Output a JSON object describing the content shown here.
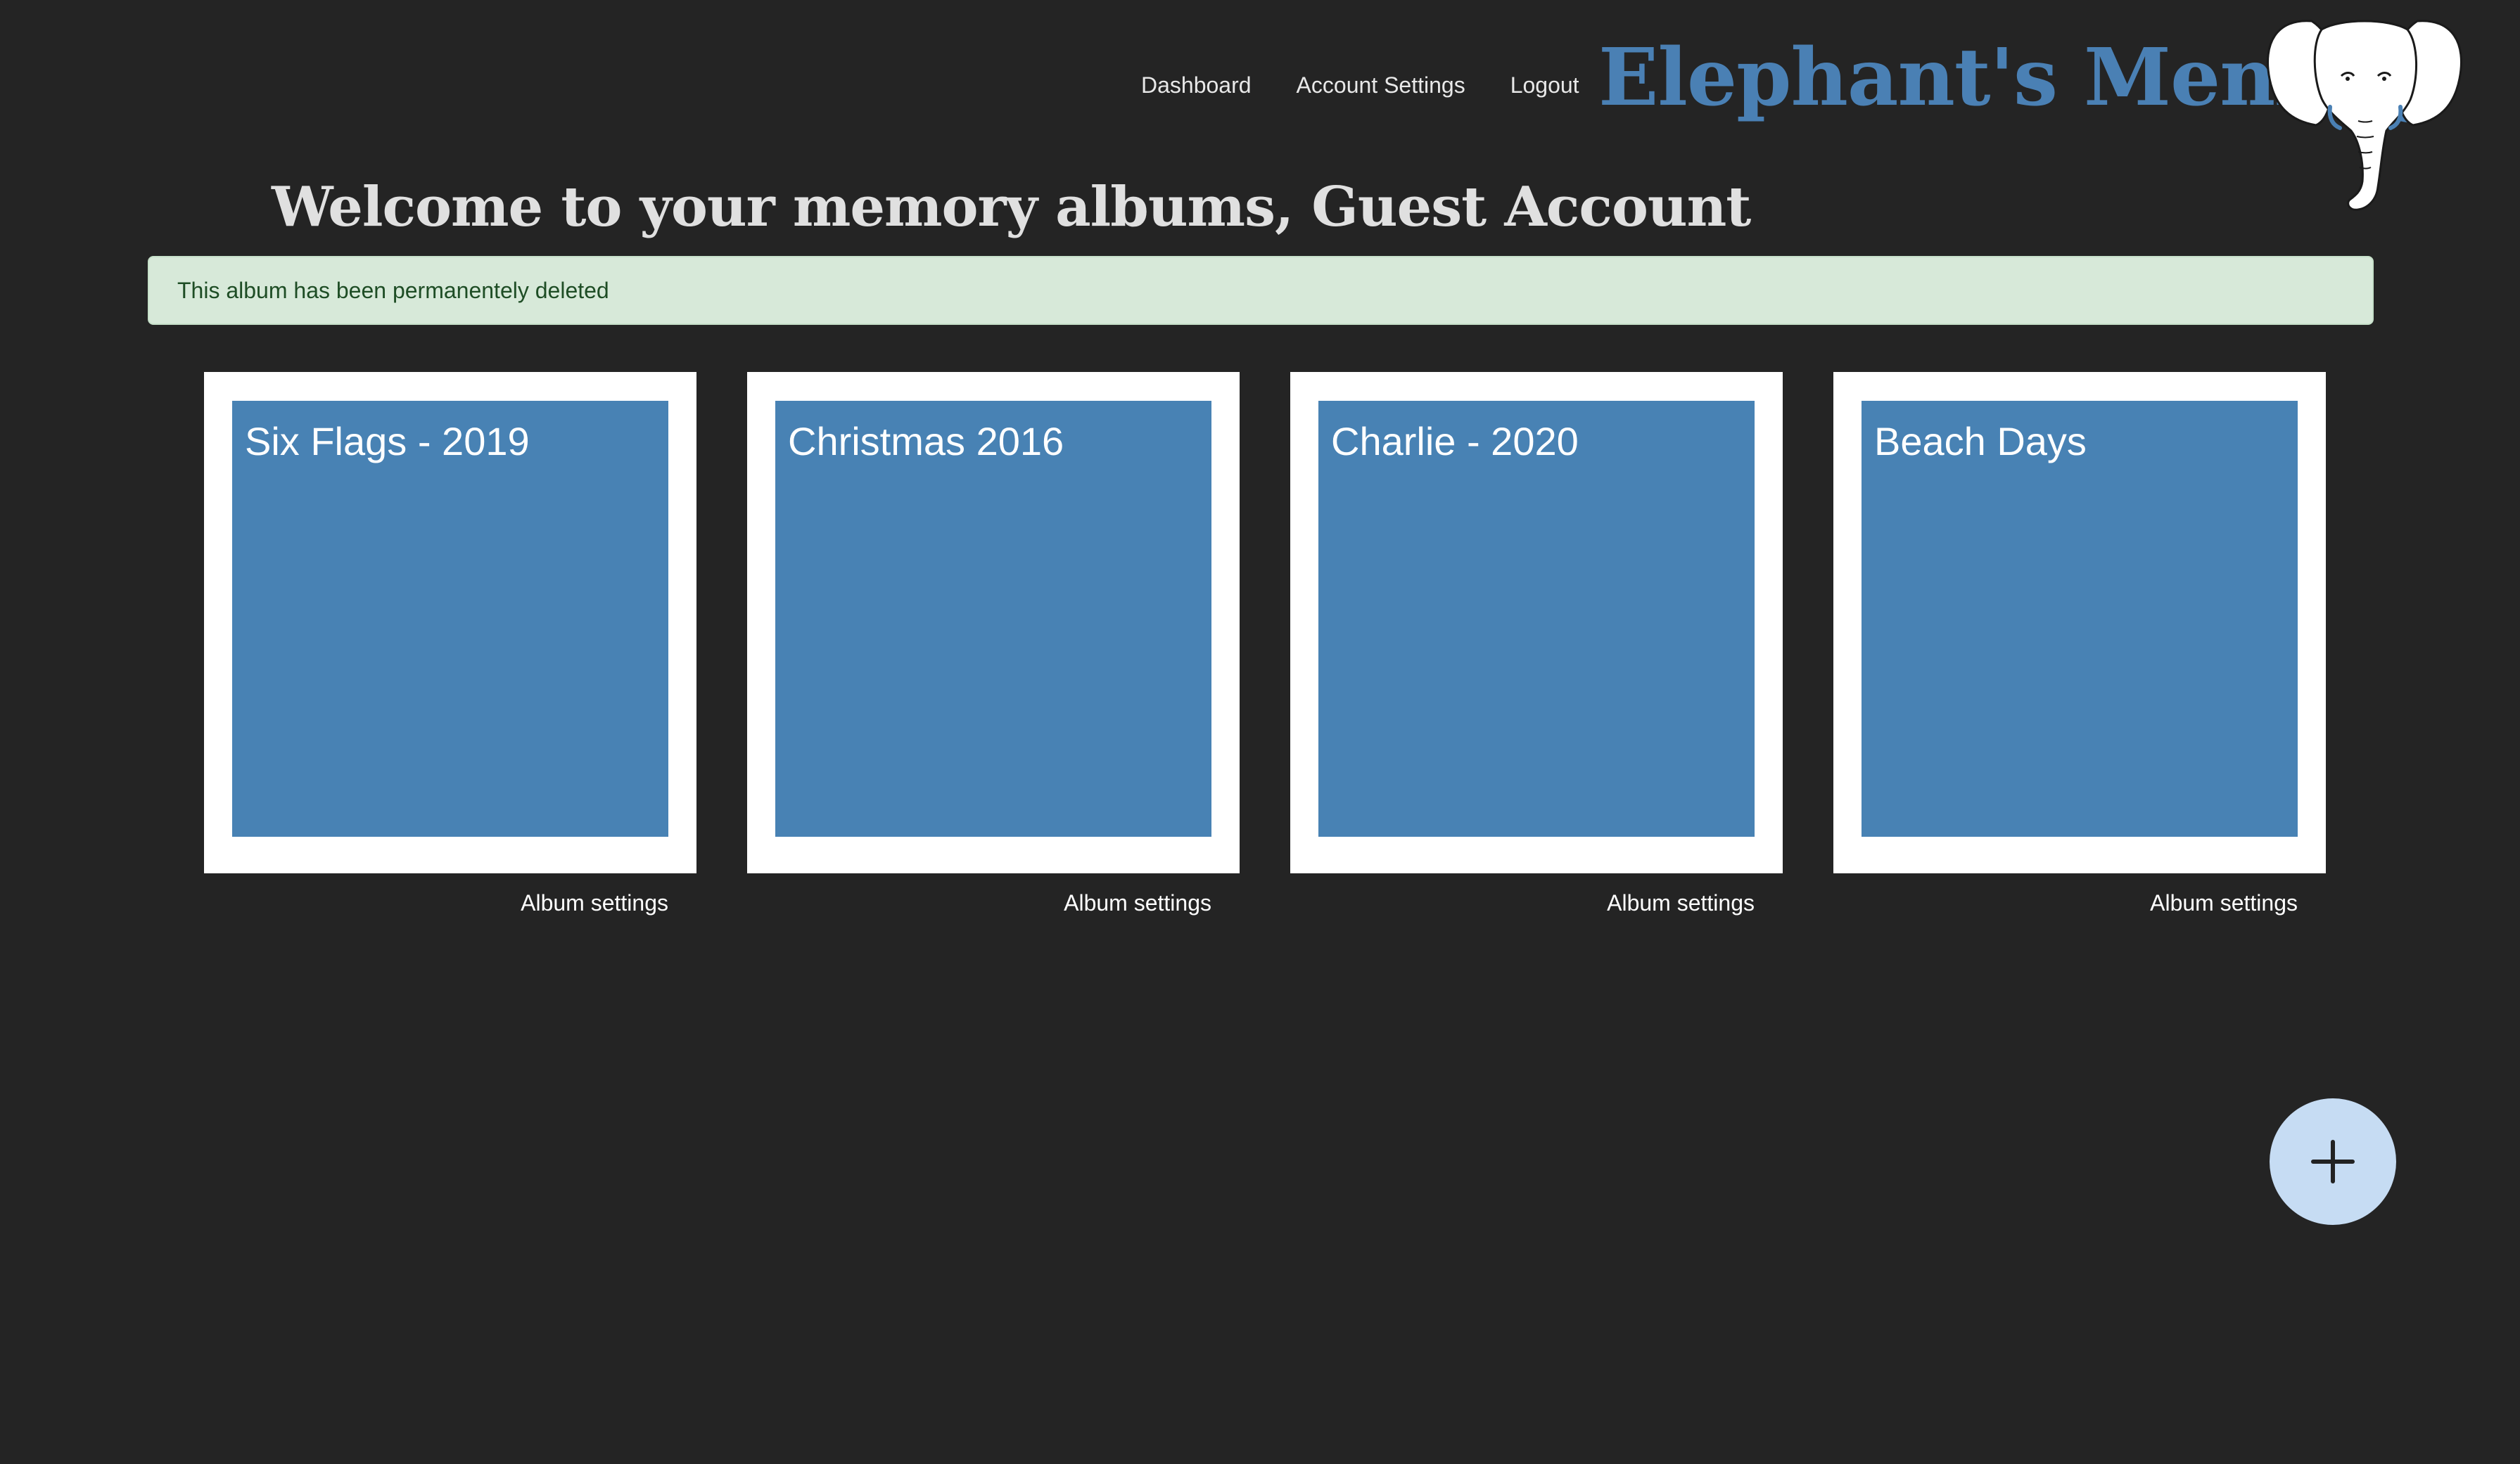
{
  "nav": {
    "items": [
      {
        "label": "Dashboard"
      },
      {
        "label": "Account Settings"
      },
      {
        "label": "Logout"
      }
    ]
  },
  "brand": {
    "title": "Elephant's Memory",
    "logo_icon": "elephant-logo-icon",
    "color": "#4a80b4"
  },
  "welcome": {
    "heading": "Welcome to your memory albums, Guest Account"
  },
  "alert": {
    "message": "This album has been permanentely deleted",
    "background": "#d7e9d9"
  },
  "albums": [
    {
      "title": "Six Flags - 2019",
      "settings_label": "Album settings"
    },
    {
      "title": "Christmas 2016",
      "settings_label": "Album settings"
    },
    {
      "title": "Charlie - 2020",
      "settings_label": "Album settings"
    },
    {
      "title": "Beach Days",
      "settings_label": "Album settings"
    }
  ],
  "fab": {
    "icon": "plus-icon",
    "background": "#c6dcf3"
  },
  "colors": {
    "page_background": "#242424",
    "album_cover": "#4882b4"
  }
}
